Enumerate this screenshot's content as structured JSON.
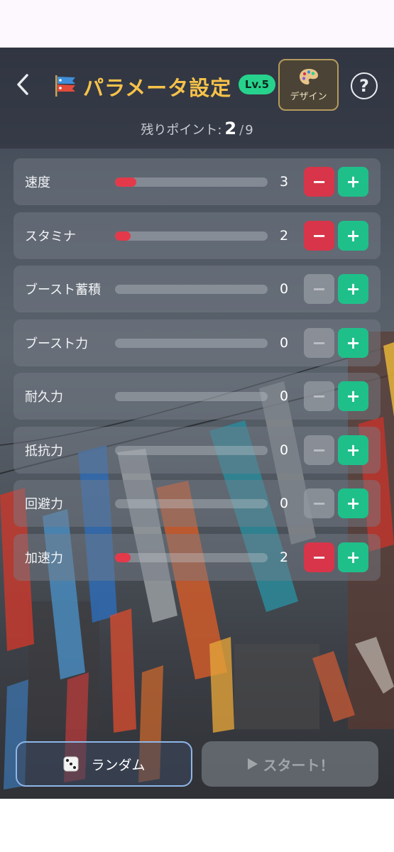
{
  "header": {
    "title": "パラメータ設定",
    "level_badge": "Lv.5",
    "design_label": "デザイン",
    "help_symbol": "?"
  },
  "points": {
    "label": "残りポイント:",
    "current": "2",
    "separator": "/",
    "total": "9"
  },
  "params": [
    {
      "label": "速度",
      "value": "3",
      "fill": 0.14,
      "minus_enabled": true
    },
    {
      "label": "スタミナ",
      "value": "2",
      "fill": 0.1,
      "minus_enabled": true
    },
    {
      "label": "ブースト蓄積",
      "value": "0",
      "fill": 0,
      "minus_enabled": false
    },
    {
      "label": "ブースト力",
      "value": "0",
      "fill": 0,
      "minus_enabled": false
    },
    {
      "label": "耐久力",
      "value": "0",
      "fill": 0,
      "minus_enabled": false
    },
    {
      "label": "抵抗力",
      "value": "0",
      "fill": 0,
      "minus_enabled": false
    },
    {
      "label": "回避力",
      "value": "0",
      "fill": 0,
      "minus_enabled": false
    },
    {
      "label": "加速力",
      "value": "2",
      "fill": 0.1,
      "minus_enabled": true
    }
  ],
  "controls": {
    "minus": "−",
    "plus": "+"
  },
  "footer": {
    "random_label": "ランダム",
    "start_label": "スタート！"
  },
  "colors": {
    "accent_gold": "#f6c24a",
    "level_green": "#27d28d",
    "minus_red": "#d8354a",
    "plus_green": "#1fbf8a",
    "bar_fill_red": "#e3394a"
  },
  "icons": [
    "back-chevron-icon",
    "koinobori-flag-icon",
    "palette-icon",
    "help-icon",
    "dice-icon",
    "play-icon"
  ]
}
